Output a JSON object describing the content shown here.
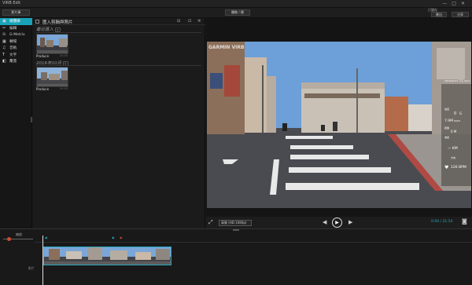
{
  "app": {
    "title": "VIRB Edit"
  },
  "window_controls": [
    "—",
    "□",
    "✕"
  ],
  "toolbar": {
    "media_button": "影片庫",
    "view_switch": "體驗 / 播",
    "save_label": "已儲存",
    "import_button": "匯出",
    "share_button": "分享"
  },
  "sidebar": {
    "items": [
      {
        "icon": "▣",
        "label": "媒體庫",
        "active": true
      },
      {
        "icon": "✂",
        "label": "編輯"
      },
      {
        "icon": "⊙",
        "label": "G-Metrix"
      },
      {
        "icon": "▦",
        "label": "轉場"
      },
      {
        "icon": "♫",
        "label": "音軌"
      },
      {
        "icon": "T",
        "label": "文字"
      },
      {
        "icon": "◧",
        "label": "覆蓋"
      }
    ]
  },
  "media_panel": {
    "title": "匯入剪輯與照片",
    "groups": [
      {
        "title": "最近匯入",
        "badge": "全",
        "clip": {
          "label": "Produce",
          "duration": "00:00"
        }
      },
      {
        "title": "2016年10月",
        "badge": "全",
        "clip": {
          "label": "Produce",
          "duration": "00:00"
        }
      }
    ]
  },
  "preview": {
    "watermark": "GARMIN VIRB",
    "overlay": {
      "date": "2016/10/17 下午 04:2",
      "speed_unit": "速度",
      "speed": "0",
      "speed_suffix": "G",
      "alt": "7.9M",
      "alt_suffix": "KM/H",
      "dist": "0 M",
      "dist_label": "距離",
      "grade_label": "坡度",
      "km": "— KM",
      "heading_label": "方向",
      "hr": "126 BPM"
    },
    "quality": "高質 (HD 1080p)",
    "timecode": "0:00 / 21:54"
  },
  "timeline": {
    "zoom_label": "縮放",
    "track_label": "影片",
    "clip_markers": [
      "◉",
      "◉"
    ]
  },
  "colors": {
    "accent": "#1aa3b8",
    "timecode": "#2aa7bd",
    "marker_red": "#d24b2f"
  }
}
